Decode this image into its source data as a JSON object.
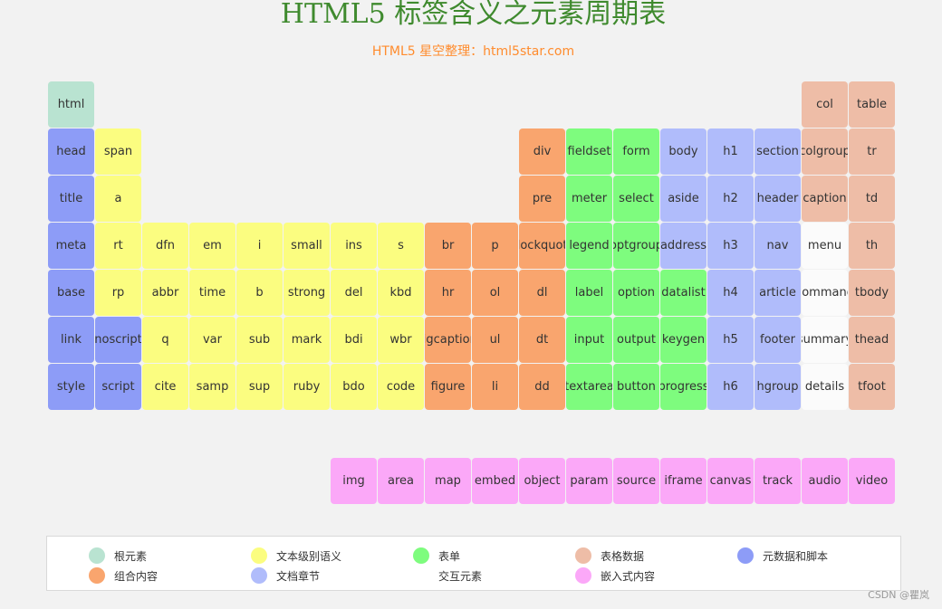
{
  "page": {
    "title": "HTML5 标签含义之元素周期表",
    "subtitle": "HTML5 星空整理：html5star.com",
    "watermark": "CSDN @瞿岚"
  },
  "colors": {
    "root": "#b9e3d1",
    "text": "#fbfd80",
    "form": "#7efc7e",
    "table": "#eebda7",
    "meta": "#8d9cf7",
    "group": "#f9a56e",
    "section": "#b0bcfb",
    "interactive": "#fbfbfb",
    "embedded": "#fba8f8"
  },
  "elements": [
    {
      "label": "html",
      "cat": "root",
      "col": 0,
      "row": 0
    },
    {
      "label": "col",
      "cat": "table",
      "col": 16,
      "row": 0
    },
    {
      "label": "table",
      "cat": "table",
      "col": 17,
      "row": 0
    },
    {
      "label": "head",
      "cat": "meta",
      "col": 0,
      "row": 1
    },
    {
      "label": "span",
      "cat": "text",
      "col": 1,
      "row": 1
    },
    {
      "label": "div",
      "cat": "group",
      "col": 10,
      "row": 1
    },
    {
      "label": "fieldset",
      "cat": "form",
      "col": 11,
      "row": 1
    },
    {
      "label": "form",
      "cat": "form",
      "col": 12,
      "row": 1
    },
    {
      "label": "body",
      "cat": "section",
      "col": 13,
      "row": 1
    },
    {
      "label": "h1",
      "cat": "section",
      "col": 14,
      "row": 1
    },
    {
      "label": "section",
      "cat": "section",
      "col": 15,
      "row": 1
    },
    {
      "label": "colgroup",
      "cat": "table",
      "col": 16,
      "row": 1
    },
    {
      "label": "tr",
      "cat": "table",
      "col": 17,
      "row": 1
    },
    {
      "label": "title",
      "cat": "meta",
      "col": 0,
      "row": 2
    },
    {
      "label": "a",
      "cat": "text",
      "col": 1,
      "row": 2
    },
    {
      "label": "pre",
      "cat": "group",
      "col": 10,
      "row": 2
    },
    {
      "label": "meter",
      "cat": "form",
      "col": 11,
      "row": 2
    },
    {
      "label": "select",
      "cat": "form",
      "col": 12,
      "row": 2
    },
    {
      "label": "aside",
      "cat": "section",
      "col": 13,
      "row": 2
    },
    {
      "label": "h2",
      "cat": "section",
      "col": 14,
      "row": 2
    },
    {
      "label": "header",
      "cat": "section",
      "col": 15,
      "row": 2
    },
    {
      "label": "caption",
      "cat": "table",
      "col": 16,
      "row": 2
    },
    {
      "label": "td",
      "cat": "table",
      "col": 17,
      "row": 2
    },
    {
      "label": "meta",
      "cat": "meta",
      "col": 0,
      "row": 3
    },
    {
      "label": "rt",
      "cat": "text",
      "col": 1,
      "row": 3
    },
    {
      "label": "dfn",
      "cat": "text",
      "col": 2,
      "row": 3
    },
    {
      "label": "em",
      "cat": "text",
      "col": 3,
      "row": 3
    },
    {
      "label": "i",
      "cat": "text",
      "col": 4,
      "row": 3
    },
    {
      "label": "small",
      "cat": "text",
      "col": 5,
      "row": 3
    },
    {
      "label": "ins",
      "cat": "text",
      "col": 6,
      "row": 3
    },
    {
      "label": "s",
      "cat": "text",
      "col": 7,
      "row": 3
    },
    {
      "label": "br",
      "cat": "group",
      "col": 8,
      "row": 3
    },
    {
      "label": "p",
      "cat": "group",
      "col": 9,
      "row": 3
    },
    {
      "label": "blockquote",
      "cat": "group",
      "col": 10,
      "row": 3
    },
    {
      "label": "legend",
      "cat": "form",
      "col": 11,
      "row": 3
    },
    {
      "label": "optgroup",
      "cat": "form",
      "col": 12,
      "row": 3
    },
    {
      "label": "address",
      "cat": "section",
      "col": 13,
      "row": 3
    },
    {
      "label": "h3",
      "cat": "section",
      "col": 14,
      "row": 3
    },
    {
      "label": "nav",
      "cat": "section",
      "col": 15,
      "row": 3
    },
    {
      "label": "menu",
      "cat": "interactive",
      "col": 16,
      "row": 3
    },
    {
      "label": "th",
      "cat": "table",
      "col": 17,
      "row": 3
    },
    {
      "label": "base",
      "cat": "meta",
      "col": 0,
      "row": 4
    },
    {
      "label": "rp",
      "cat": "text",
      "col": 1,
      "row": 4
    },
    {
      "label": "abbr",
      "cat": "text",
      "col": 2,
      "row": 4
    },
    {
      "label": "time",
      "cat": "text",
      "col": 3,
      "row": 4
    },
    {
      "label": "b",
      "cat": "text",
      "col": 4,
      "row": 4
    },
    {
      "label": "strong",
      "cat": "text",
      "col": 5,
      "row": 4
    },
    {
      "label": "del",
      "cat": "text",
      "col": 6,
      "row": 4
    },
    {
      "label": "kbd",
      "cat": "text",
      "col": 7,
      "row": 4
    },
    {
      "label": "hr",
      "cat": "group",
      "col": 8,
      "row": 4
    },
    {
      "label": "ol",
      "cat": "group",
      "col": 9,
      "row": 4
    },
    {
      "label": "dl",
      "cat": "group",
      "col": 10,
      "row": 4
    },
    {
      "label": "label",
      "cat": "form",
      "col": 11,
      "row": 4
    },
    {
      "label": "option",
      "cat": "form",
      "col": 12,
      "row": 4
    },
    {
      "label": "datalist",
      "cat": "form",
      "col": 13,
      "row": 4
    },
    {
      "label": "h4",
      "cat": "section",
      "col": 14,
      "row": 4
    },
    {
      "label": "article",
      "cat": "section",
      "col": 15,
      "row": 4
    },
    {
      "label": "command",
      "cat": "interactive",
      "col": 16,
      "row": 4
    },
    {
      "label": "tbody",
      "cat": "table",
      "col": 17,
      "row": 4
    },
    {
      "label": "link",
      "cat": "meta",
      "col": 0,
      "row": 5
    },
    {
      "label": "noscript",
      "cat": "meta",
      "col": 1,
      "row": 5
    },
    {
      "label": "q",
      "cat": "text",
      "col": 2,
      "row": 5
    },
    {
      "label": "var",
      "cat": "text",
      "col": 3,
      "row": 5
    },
    {
      "label": "sub",
      "cat": "text",
      "col": 4,
      "row": 5
    },
    {
      "label": "mark",
      "cat": "text",
      "col": 5,
      "row": 5
    },
    {
      "label": "bdi",
      "cat": "text",
      "col": 6,
      "row": 5
    },
    {
      "label": "wbr",
      "cat": "text",
      "col": 7,
      "row": 5
    },
    {
      "label": "figcaption",
      "cat": "group",
      "col": 8,
      "row": 5
    },
    {
      "label": "ul",
      "cat": "group",
      "col": 9,
      "row": 5
    },
    {
      "label": "dt",
      "cat": "group",
      "col": 10,
      "row": 5
    },
    {
      "label": "input",
      "cat": "form",
      "col": 11,
      "row": 5
    },
    {
      "label": "output",
      "cat": "form",
      "col": 12,
      "row": 5
    },
    {
      "label": "keygen",
      "cat": "form",
      "col": 13,
      "row": 5
    },
    {
      "label": "h5",
      "cat": "section",
      "col": 14,
      "row": 5
    },
    {
      "label": "footer",
      "cat": "section",
      "col": 15,
      "row": 5
    },
    {
      "label": "summary",
      "cat": "interactive",
      "col": 16,
      "row": 5
    },
    {
      "label": "thead",
      "cat": "table",
      "col": 17,
      "row": 5
    },
    {
      "label": "style",
      "cat": "meta",
      "col": 0,
      "row": 6
    },
    {
      "label": "script",
      "cat": "meta",
      "col": 1,
      "row": 6
    },
    {
      "label": "cite",
      "cat": "text",
      "col": 2,
      "row": 6
    },
    {
      "label": "samp",
      "cat": "text",
      "col": 3,
      "row": 6
    },
    {
      "label": "sup",
      "cat": "text",
      "col": 4,
      "row": 6
    },
    {
      "label": "ruby",
      "cat": "text",
      "col": 5,
      "row": 6
    },
    {
      "label": "bdo",
      "cat": "text",
      "col": 6,
      "row": 6
    },
    {
      "label": "code",
      "cat": "text",
      "col": 7,
      "row": 6
    },
    {
      "label": "figure",
      "cat": "group",
      "col": 8,
      "row": 6
    },
    {
      "label": "li",
      "cat": "group",
      "col": 9,
      "row": 6
    },
    {
      "label": "dd",
      "cat": "group",
      "col": 10,
      "row": 6
    },
    {
      "label": "textarea",
      "cat": "form",
      "col": 11,
      "row": 6
    },
    {
      "label": "button",
      "cat": "form",
      "col": 12,
      "row": 6
    },
    {
      "label": "progress",
      "cat": "form",
      "col": 13,
      "row": 6
    },
    {
      "label": "h6",
      "cat": "section",
      "col": 14,
      "row": 6
    },
    {
      "label": "hgroup",
      "cat": "section",
      "col": 15,
      "row": 6
    },
    {
      "label": "details",
      "cat": "interactive",
      "col": 16,
      "row": 6
    },
    {
      "label": "tfoot",
      "cat": "table",
      "col": 17,
      "row": 6
    },
    {
      "label": "img",
      "cat": "embedded",
      "col": 6,
      "row": 8
    },
    {
      "label": "area",
      "cat": "embedded",
      "col": 7,
      "row": 8
    },
    {
      "label": "map",
      "cat": "embedded",
      "col": 8,
      "row": 8
    },
    {
      "label": "embed",
      "cat": "embedded",
      "col": 9,
      "row": 8
    },
    {
      "label": "object",
      "cat": "embedded",
      "col": 10,
      "row": 8
    },
    {
      "label": "param",
      "cat": "embedded",
      "col": 11,
      "row": 8
    },
    {
      "label": "source",
      "cat": "embedded",
      "col": 12,
      "row": 8
    },
    {
      "label": "iframe",
      "cat": "embedded",
      "col": 13,
      "row": 8
    },
    {
      "label": "canvas",
      "cat": "embedded",
      "col": 14,
      "row": 8
    },
    {
      "label": "track",
      "cat": "embedded",
      "col": 15,
      "row": 8
    },
    {
      "label": "audio",
      "cat": "embedded",
      "col": 16,
      "row": 8
    },
    {
      "label": "video",
      "cat": "embedded",
      "col": 17,
      "row": 8
    }
  ],
  "legend": [
    {
      "label": "根元素",
      "cat": "root"
    },
    {
      "label": "文本级别语义",
      "cat": "text"
    },
    {
      "label": "表单",
      "cat": "form"
    },
    {
      "label": "表格数据",
      "cat": "table"
    },
    {
      "label": "元数据和脚本",
      "cat": "meta"
    },
    {
      "label": "组合内容",
      "cat": "group"
    },
    {
      "label": "文档章节",
      "cat": "section"
    },
    {
      "label": "交互元素",
      "cat": "interactive"
    },
    {
      "label": "嵌入式内容",
      "cat": "embedded"
    }
  ]
}
